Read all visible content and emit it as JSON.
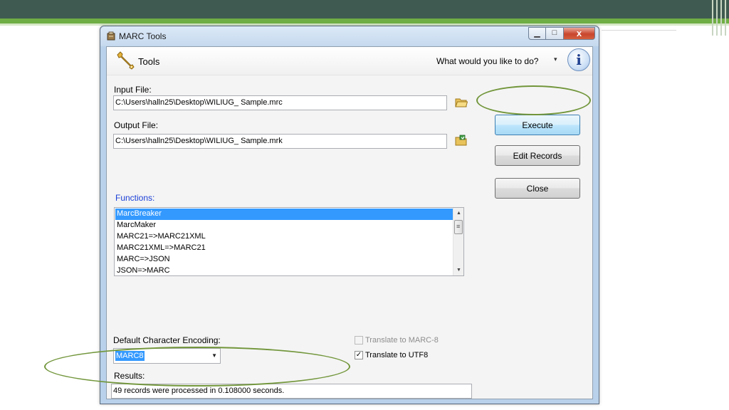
{
  "window": {
    "title": "MARC Tools",
    "controls": {
      "minimize": "▁",
      "maximize": "□",
      "close": "x"
    }
  },
  "toolbar": {
    "tools_label": "Tools",
    "action_prompt": "What would you like to do?",
    "dropdown_arrow": "▾",
    "info_glyph": "i"
  },
  "input_file": {
    "label": "Input File:",
    "value": "C:\\Users\\halln25\\Desktop\\WILIUG_ Sample.mrc"
  },
  "output_file": {
    "label": "Output File:",
    "value": "C:\\Users\\halln25\\Desktop\\WILIUG_ Sample.mrk"
  },
  "buttons": {
    "execute": "Execute",
    "edit_records": "Edit Records",
    "close": "Close"
  },
  "functions": {
    "label": "Functions:",
    "items": [
      "MarcBreaker",
      "MarcMaker",
      "MARC21=>MARC21XML",
      "MARC21XML=>MARC21",
      "MARC=>JSON",
      "JSON=>MARC"
    ],
    "selected_index": 0
  },
  "encoding": {
    "label": "Default Character Encoding:",
    "value": "MARC8"
  },
  "options": {
    "translate_marc8": {
      "label": "Translate to MARC-8",
      "checked": false,
      "enabled": false
    },
    "translate_utf8": {
      "label": "Translate to UTF8",
      "checked": true,
      "enabled": true
    }
  },
  "results": {
    "label": "Results:",
    "value": "49 records were processed in 0.108000 seconds."
  },
  "icons": [
    "app-icon",
    "wrench-icon",
    "info-icon",
    "folder-open-icon",
    "folder-save-icon",
    "chevron-down-icon"
  ],
  "colors": {
    "accent_stripe": "#6fae45",
    "header_band": "#3f5a50",
    "highlight": "#72963b",
    "selection": "#3399ff",
    "functions_label": "#1a3fd6"
  }
}
